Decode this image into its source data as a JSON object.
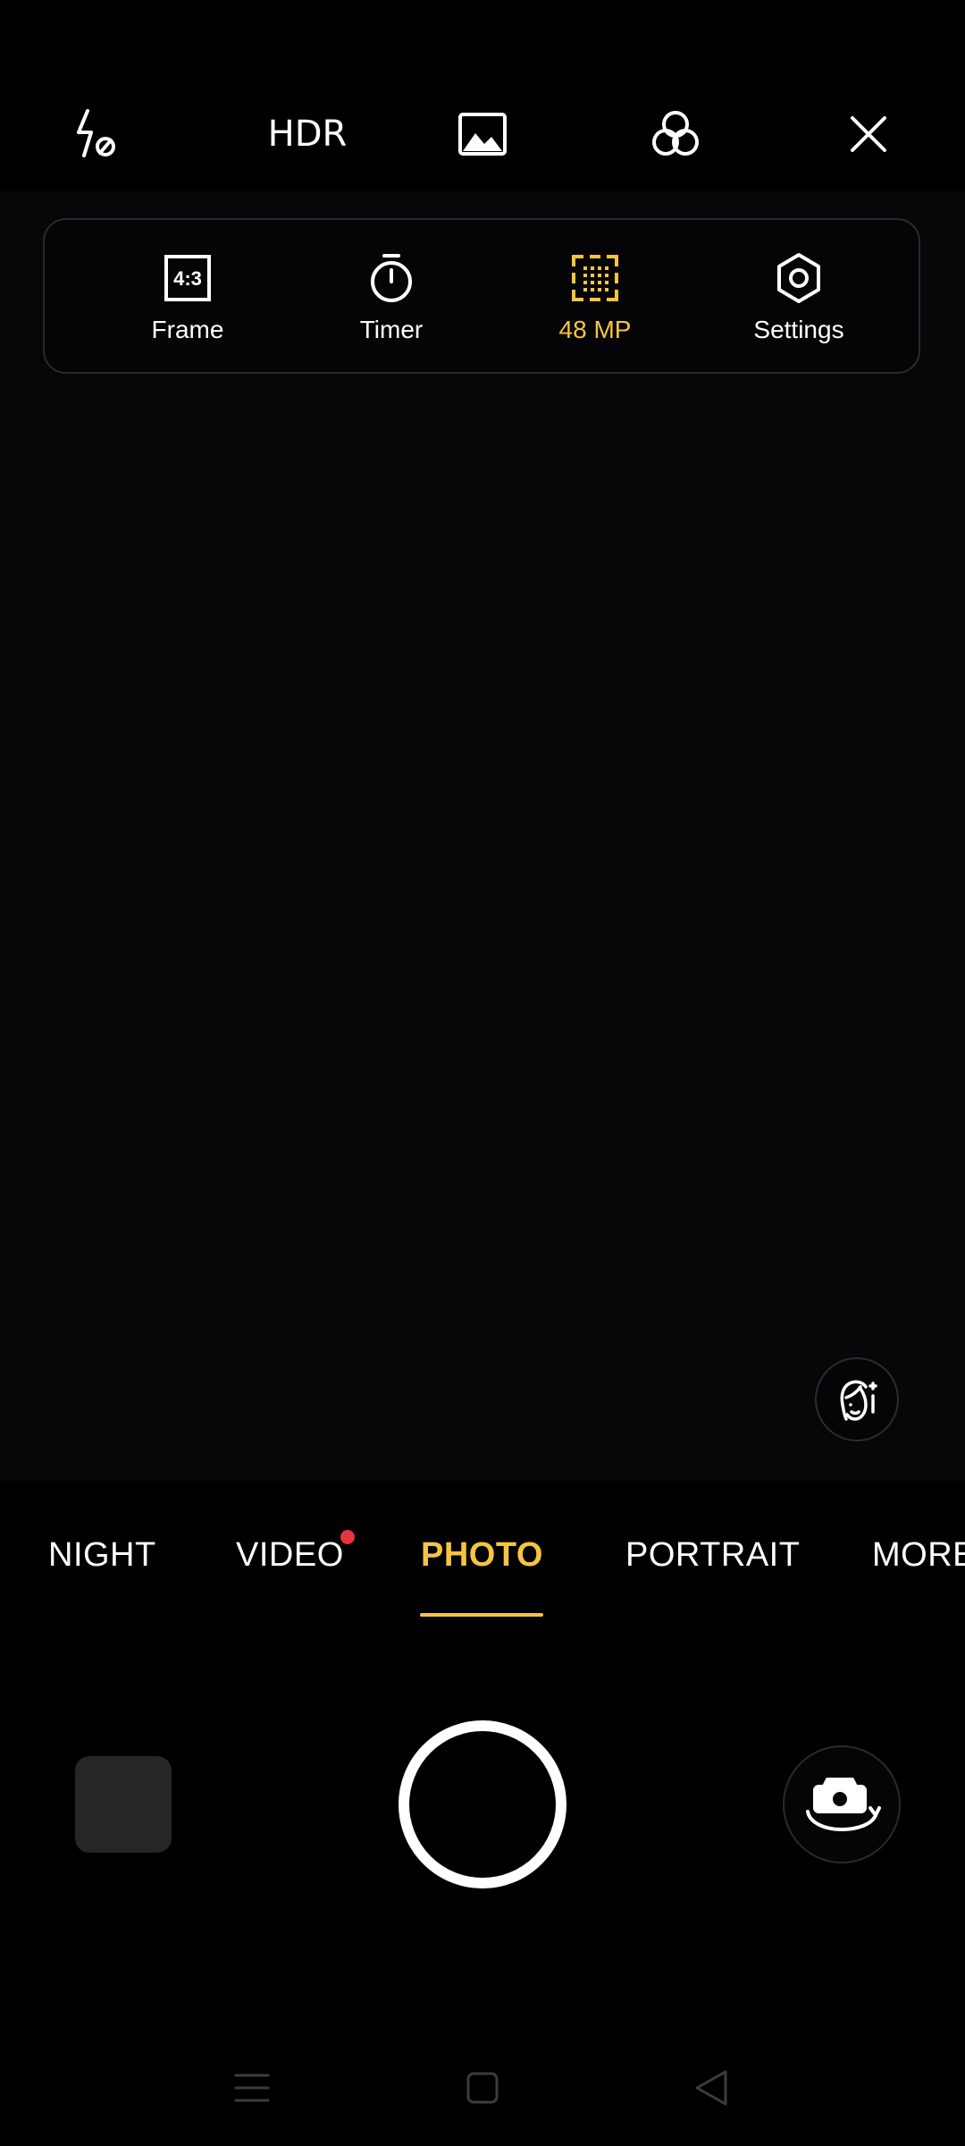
{
  "top_bar": {
    "flash_icon": "flash-off-icon",
    "hdr_label": "HDR",
    "image_icon": "image-icon",
    "filter_icon": "filter-icon",
    "close_icon": "close-icon"
  },
  "quick_settings": {
    "items": [
      {
        "label": "Frame",
        "icon": "aspect-ratio-icon",
        "icon_text": "4:3"
      },
      {
        "label": "Timer",
        "icon": "timer-icon"
      },
      {
        "label": "48 MP",
        "icon": "resolution-icon",
        "active": true
      },
      {
        "label": "Settings",
        "icon": "settings-icon"
      }
    ]
  },
  "modes": [
    {
      "label": "NIGHT"
    },
    {
      "label": "VIDEO",
      "new": true
    },
    {
      "label": "PHOTO",
      "active": true
    },
    {
      "label": "PORTRAIT"
    },
    {
      "label": "MORE"
    }
  ],
  "colors": {
    "accent": "#f5c542",
    "notification_dot": "#e5363f",
    "background": "#000000"
  }
}
